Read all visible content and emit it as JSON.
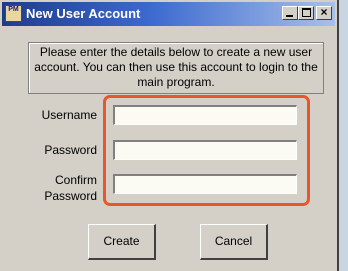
{
  "window": {
    "title": "New User Account",
    "icon_name": "app-icon",
    "icon_text": "PM",
    "controls": {
      "minimize": "minimize-icon",
      "maximize": "maximize-icon",
      "close_label": "×"
    }
  },
  "info": {
    "message": "Please enter the details below to create a new user account. You can then use this account to login to the main program."
  },
  "form": {
    "username_label": "Username",
    "username_value": "",
    "password_label": "Password",
    "password_value": "",
    "confirm_label_line1": "Confirm",
    "confirm_label_line2": "Password",
    "confirm_value": ""
  },
  "buttons": {
    "create_label": "Create",
    "cancel_label": "Cancel"
  },
  "colors": {
    "highlight": "#e8562e",
    "titlebar_start": "#1e3c8c",
    "titlebar_end": "#a8c0e8",
    "dialog_bg": "#d4d0c8"
  }
}
